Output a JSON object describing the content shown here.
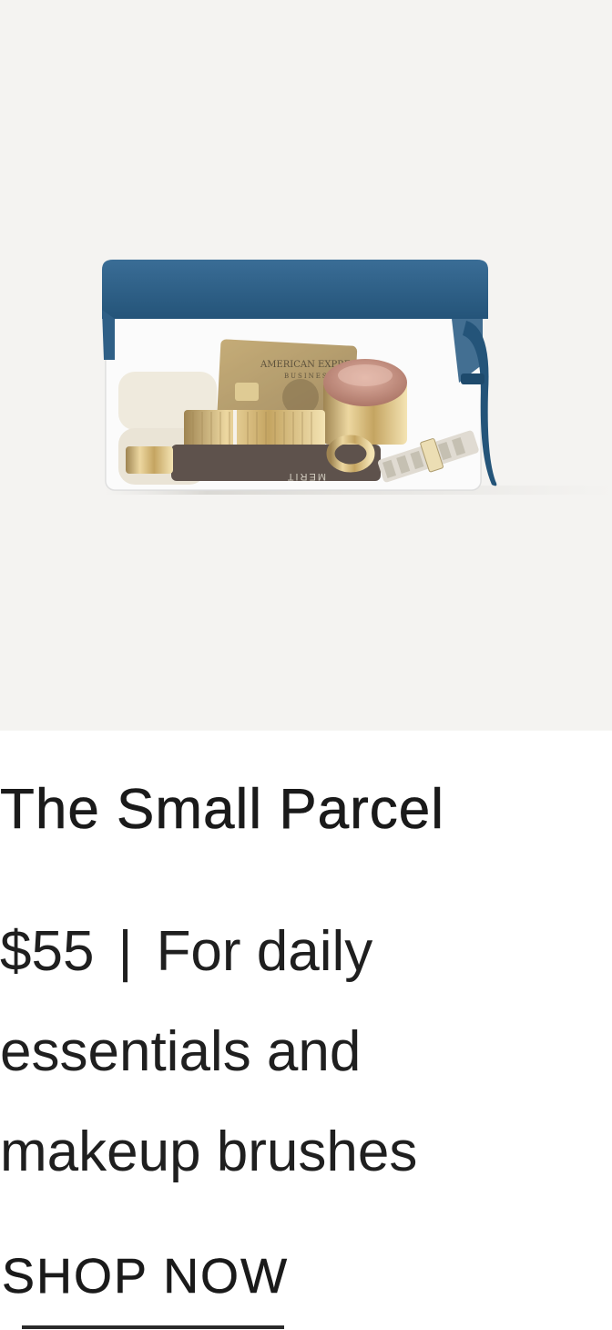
{
  "product": {
    "image_alt": "The Small Parcel pouch with items",
    "card_text": "AMERICAN EXPRESS",
    "card_subtext": "BUSINESS",
    "brand_mark": "MERIT",
    "title": "The Small Parcel",
    "price": "$55",
    "separator": "|",
    "description": "For daily essentials and makeup brushes",
    "cta_label": "SHOP NOW"
  },
  "colors": {
    "hero_bg": "#f4f3f1",
    "pouch_blue": "#2f5f86",
    "text": "#1a1a1a"
  }
}
